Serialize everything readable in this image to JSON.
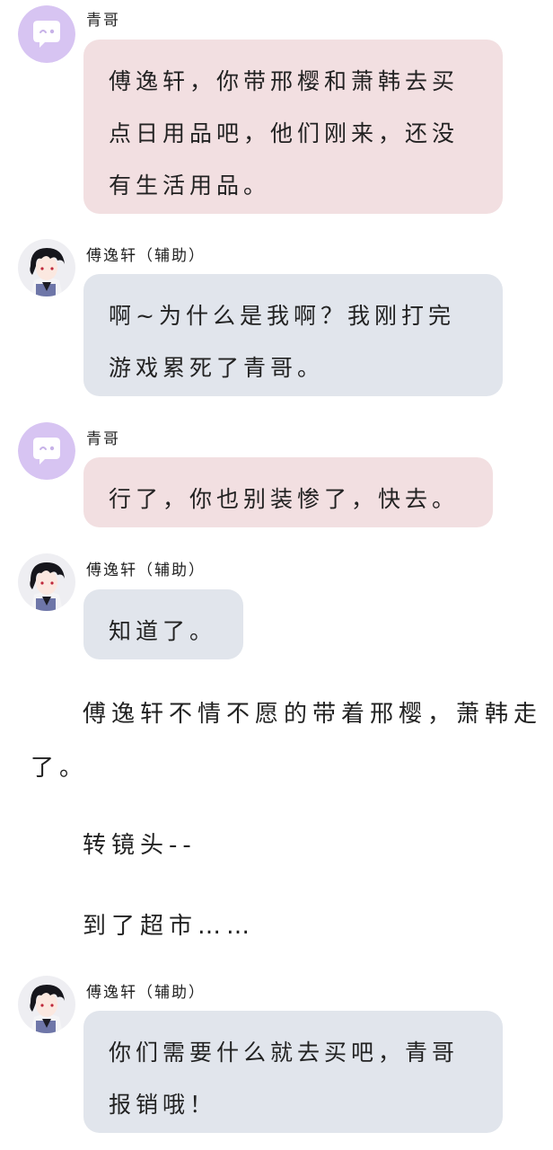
{
  "messages": [
    {
      "speaker": "青哥",
      "lines": [
        "傅逸轩，你带邢樱和萧韩去买",
        "点日用品吧，他们刚来，还没",
        "有生活用品。"
      ]
    },
    {
      "speaker": "傅逸轩（辅助）",
      "lines": [
        "啊~为什么是我啊？我刚打完",
        "游戏累死了青哥。"
      ]
    },
    {
      "speaker": "青哥",
      "lines": [
        "行了，你也别装惨了，快去。"
      ]
    },
    {
      "speaker": "傅逸轩（辅助）",
      "lines": [
        "知道了。"
      ]
    },
    {
      "speaker": "傅逸轩（辅助）",
      "lines": [
        "你们需要什么就去买吧，青哥",
        "报销哦！"
      ]
    }
  ],
  "narration": {
    "line1": "傅逸轩不情不愿的带着邢樱，萧韩走",
    "line1_cont": "了。",
    "line2": "转镜头--",
    "line3": "到了超市……"
  },
  "colors": {
    "pink_bubble": "#f2dfe1",
    "blue_bubble": "#e1e5ec",
    "bot_avatar": "#d7c4f2"
  },
  "icons": {
    "bot_avatar": "chat-bubble-face-icon",
    "character_avatar": "anime-boy-avatar"
  }
}
